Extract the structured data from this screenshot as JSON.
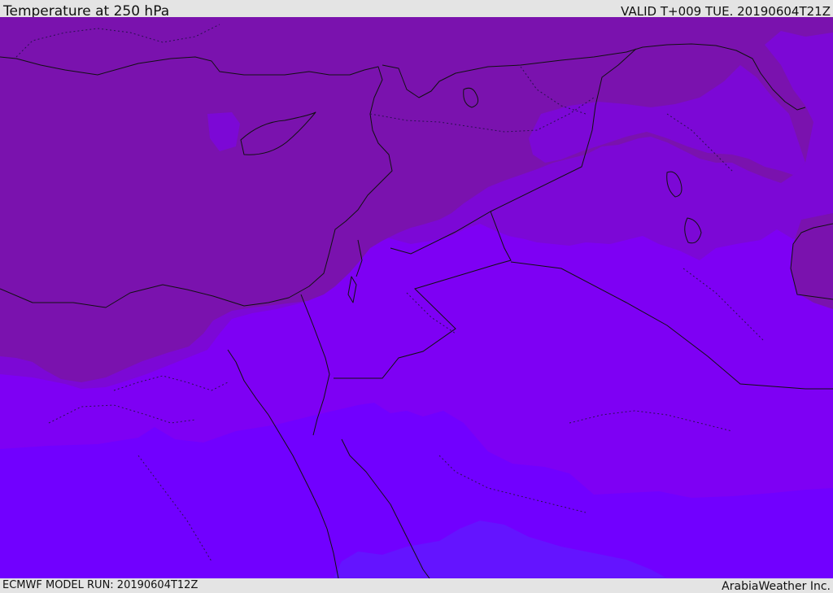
{
  "header": {
    "title": "Temperature at 250 hPa",
    "valid": "VALID T+009 TUE. 20190604T21Z"
  },
  "footer": {
    "model_run": "ECMWF MODEL RUN: 20190604T12Z",
    "credit": "ArabiaWeather Inc."
  },
  "colors": {
    "band_coldest": "#7a12ae",
    "band_cool": "#7c08d6",
    "band_mid": "#7e00f4",
    "band_warm": "#7100ff",
    "band_warmest": "#6414ff",
    "coastline": "#111111",
    "border": "#2a1050"
  }
}
